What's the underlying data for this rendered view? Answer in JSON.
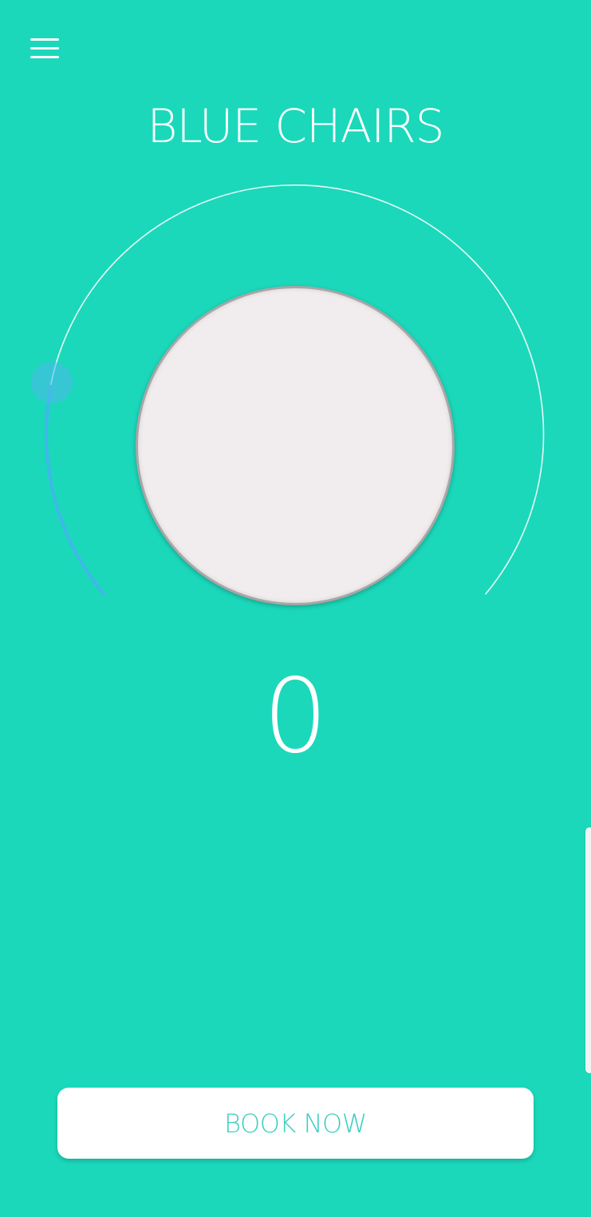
{
  "colors": {
    "background": "#1bd8bb",
    "title_text": "#ffffff",
    "track": "#e8f7f3",
    "progress_arc": "#3fb7ea",
    "handle": "#4fb9ea",
    "disc_fill": "#f1eced",
    "button_text": "#3ccfc0",
    "scroll_indicator": "#f2f2f2"
  },
  "header": {
    "menu_icon": "hamburger-menu-icon",
    "title": "BLUE CHAIRS"
  },
  "dial": {
    "value": 0
  },
  "count_display": "0",
  "actions": {
    "book_label": "BOOK NOW"
  }
}
